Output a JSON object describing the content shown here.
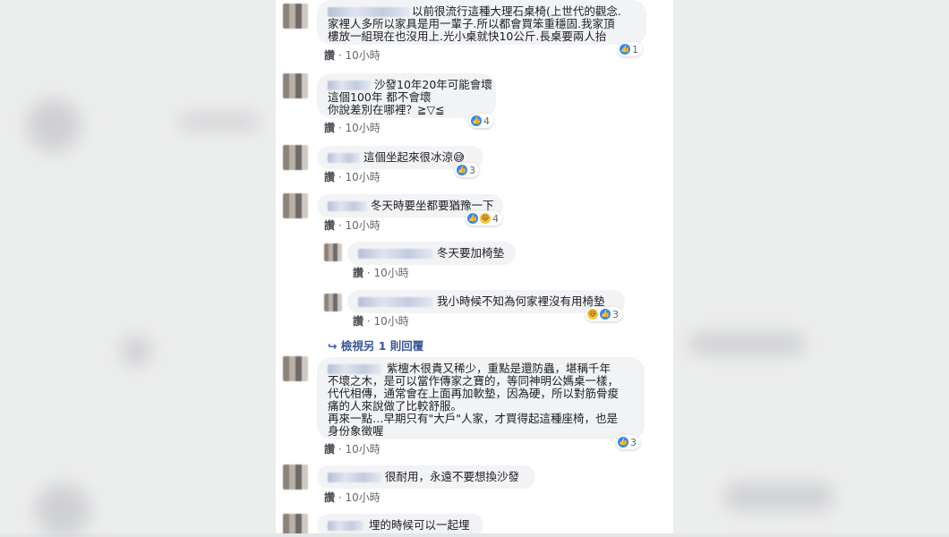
{
  "comments": [
    {
      "text_lines": [
        "以前很流行這種大理石桌椅(上世代的觀念.",
        "家裡人多所以家具是用一輩子.所以都會買笨重穩固.我家頂",
        "樓放一組現在也沒用上.光小桌就快10公斤.長桌要兩人抬"
      ],
      "reactions": "1",
      "meta_like": "讚",
      "meta_time": "10小時"
    },
    {
      "text_lines": [
        "沙發10年20年可能會壞",
        "這個100年 都不會壞",
        "你說差別在哪裡？≧▽≦"
      ],
      "reactions": "4",
      "meta_like": "讚",
      "meta_time": "10小時"
    },
    {
      "text_lines": [
        "這個坐起來很冰涼😅"
      ],
      "reactions": "3",
      "meta_like": "讚",
      "meta_time": "10小時"
    },
    {
      "text_lines": [
        "冬天時要坐都要猶豫一下"
      ],
      "reactions": "4",
      "meta_like": "讚",
      "meta_time": "10小時"
    },
    {
      "text_lines": [
        "冬天要加椅墊"
      ],
      "reactions": "",
      "meta_like": "讚",
      "meta_time": "10小時"
    },
    {
      "text_lines": [
        "我小時候不知為何家裡沒有用椅墊"
      ],
      "reactions": "3",
      "meta_like": "讚",
      "meta_time": "10小時"
    },
    {
      "text_lines": [
        "紫檀木很貴又稀少，重點是還防蟲，堪稱千年",
        "不壞之木，是可以當作傳家之寶的，等同神明公媽桌一樣，",
        "代代相傳，通常會在上面再加軟墊，因為硬，所以對筋骨痠",
        "痛的人來說做了比較舒服。",
        "再來一點…早期只有\"大戶\"人家，才買得起這種座椅，也是",
        "身份象徵喔"
      ],
      "reactions": "3",
      "meta_like": "讚",
      "meta_time": "10小時"
    },
    {
      "text_lines": [
        "很耐用，永遠不要想換沙發"
      ],
      "reactions": "",
      "meta_like": "讚",
      "meta_time": "10小時"
    },
    {
      "text_lines": [
        "埋的時候可以一起埋"
      ],
      "reactions": "",
      "meta_like": "",
      "meta_time": ""
    }
  ],
  "more_replies_label": "檢視另 1 則回覆",
  "colors": {
    "link": "#385898",
    "bubble": "#f2f3f5",
    "like": "#2d88ff"
  }
}
